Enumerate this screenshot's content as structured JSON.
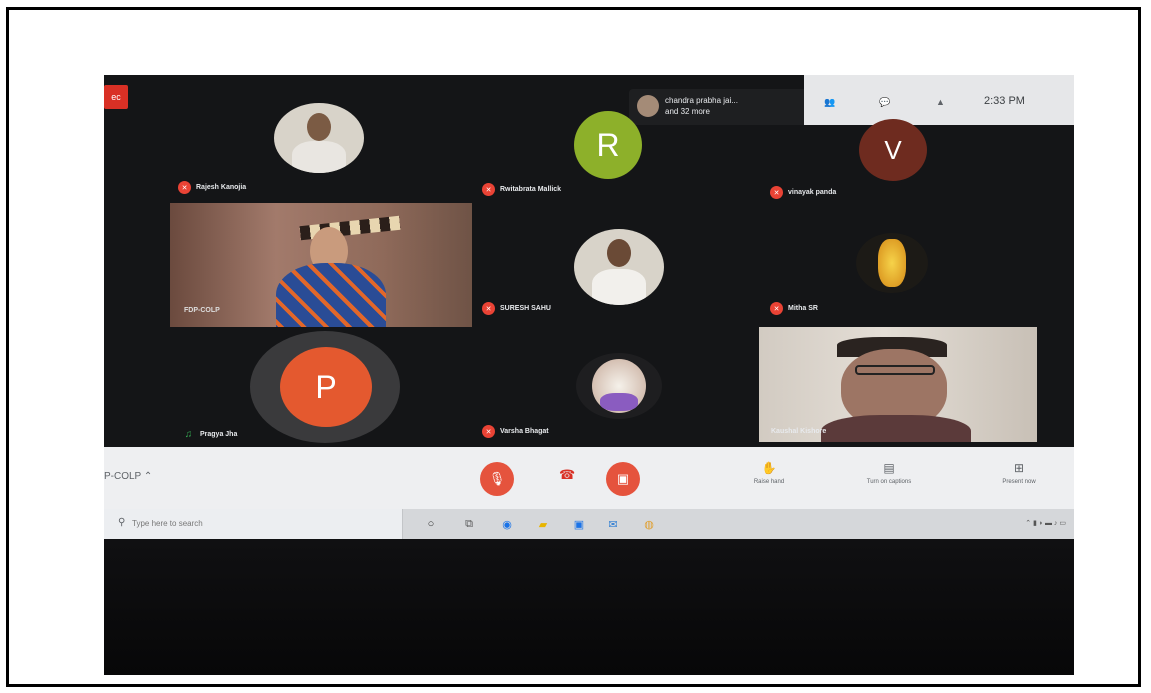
{
  "meeting": {
    "rec_label": "ec",
    "overflow": {
      "line1": "chandra prabha jai...",
      "line2": "and 32 more"
    },
    "topbar": {
      "time": "2:33 PM"
    },
    "meeting_code": "P-COLP",
    "participants": [
      {
        "name": "Rajesh Kanojia",
        "muted": true
      },
      {
        "name": "Rwitabrata Mallick",
        "muted": true,
        "letter": "R",
        "color": "#8db02a"
      },
      {
        "name": "vinayak panda",
        "muted": true,
        "letter": "V",
        "color": "#6e2b1f"
      },
      {
        "name": "FDP-COLP",
        "muted": false
      },
      {
        "name": "SURESH SAHU",
        "muted": true
      },
      {
        "name": "Mitha SR",
        "muted": true
      },
      {
        "name": "Pragya Jha",
        "muted": false,
        "letter": "P",
        "color": "#e4592f"
      },
      {
        "name": "Varsha Bhagat",
        "muted": true
      },
      {
        "name": "Kaushal Kishore",
        "muted": false
      }
    ],
    "controls": {
      "raise_hand": "Raise hand",
      "captions": "Turn on captions",
      "present": "Present now"
    }
  },
  "taskbar": {
    "search_placeholder": "Type here to search",
    "apps": [
      "search-icon",
      "task-view-icon",
      "edge-icon",
      "file-explorer-icon",
      "store-icon",
      "mail-icon",
      "chrome-icon"
    ]
  }
}
